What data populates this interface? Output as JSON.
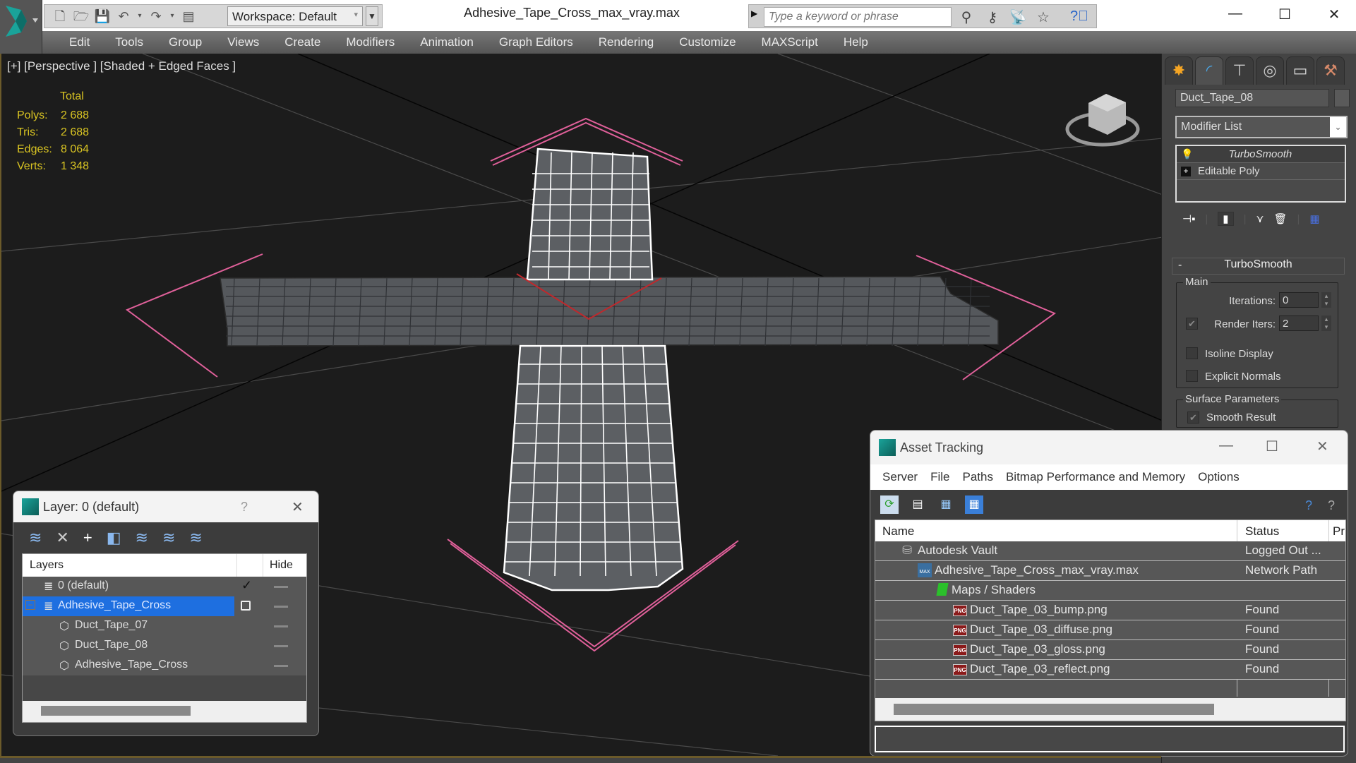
{
  "app": {
    "document_title": "Adhesive_Tape_Cross_max_vray.max",
    "workspace_label": "Workspace: Default",
    "search_placeholder": "Type a keyword or phrase",
    "window_controls": {
      "minimize": "—",
      "maximize": "☐",
      "close": "✕"
    }
  },
  "menubar": {
    "items": [
      "Edit",
      "Tools",
      "Group",
      "Views",
      "Create",
      "Modifiers",
      "Animation",
      "Graph Editors",
      "Rendering",
      "Customize",
      "MAXScript",
      "Help"
    ]
  },
  "viewport": {
    "label": "[+] [Perspective ] [Shaded + Edged Faces ]",
    "stats": {
      "header": "Total",
      "rows": [
        {
          "label": "Polys:",
          "value": "2 688"
        },
        {
          "label": "Tris:",
          "value": "2 688"
        },
        {
          "label": "Edges:",
          "value": "8 064"
        },
        {
          "label": "Verts:",
          "value": "1 348"
        }
      ]
    },
    "colors": {
      "background": "#1c1c1c",
      "stat_text": "#d9c422",
      "selection_bracket": "#e0609a",
      "wire": "#ffffff",
      "mesh": "#5a5c60",
      "axis": "#c0282c"
    }
  },
  "command_panel": {
    "tabs": [
      "create",
      "modify",
      "hierarchy",
      "motion",
      "display",
      "utilities"
    ],
    "object_name": "Duct_Tape_08",
    "modifier_list_label": "Modifier List",
    "stack": [
      {
        "label": "TurboSmooth",
        "italic": true
      },
      {
        "label": "Editable Poly",
        "italic": false
      }
    ],
    "turbosmooth": {
      "title": "TurboSmooth",
      "collapse": "-",
      "main_group": "Main",
      "iterations_label": "Iterations:",
      "iterations_value": "0",
      "render_iters_label": "Render Iters:",
      "render_iters_value": "2",
      "render_iters_checked": true,
      "isoline_label": "Isoline Display",
      "isoline_checked": false,
      "explicit_normals_label": "Explicit Normals",
      "explicit_normals_checked": false,
      "surface_group": "Surface Parameters",
      "smooth_result_label": "Smooth Result",
      "smooth_result_checked": true
    }
  },
  "layer_dialog": {
    "title": "Layer: 0 (default)",
    "help": "?",
    "close": "✕",
    "columns": {
      "layers": "Layers",
      "hide": "Hide"
    },
    "rows": [
      {
        "label": "0 (default)",
        "type": "layer",
        "active": true,
        "selected": false,
        "indent": 1
      },
      {
        "label": "Adhesive_Tape_Cross",
        "type": "layer",
        "active": false,
        "selected": true,
        "indent": 1,
        "expanded": true
      },
      {
        "label": "Duct_Tape_07",
        "type": "object",
        "active": false,
        "selected": false,
        "indent": 2
      },
      {
        "label": "Duct_Tape_08",
        "type": "object",
        "active": false,
        "selected": false,
        "indent": 2
      },
      {
        "label": "Adhesive_Tape_Cross",
        "type": "object",
        "active": false,
        "selected": false,
        "indent": 2
      }
    ],
    "selection_color": "#1e6fe0"
  },
  "asset_tracking": {
    "title": "Asset Tracking",
    "menu": [
      "Server",
      "File",
      "Paths",
      "Bitmap Performance and Memory",
      "Options"
    ],
    "columns": {
      "name": "Name",
      "status": "Status",
      "extra": "Pr"
    },
    "rows": [
      {
        "name": "Autodesk Vault",
        "status": "Logged Out ...",
        "icon": "vault-icon",
        "indent": 0
      },
      {
        "name": "Adhesive_Tape_Cross_max_vray.max",
        "status": "Network Path",
        "icon": "max-file-icon",
        "indent": 1
      },
      {
        "name": "Maps / Shaders",
        "status": "",
        "icon": "maps-icon",
        "indent": 2
      },
      {
        "name": "Duct_Tape_03_bump.png",
        "status": "Found",
        "icon": "png-icon",
        "indent": 3
      },
      {
        "name": "Duct_Tape_03_diffuse.png",
        "status": "Found",
        "icon": "png-icon",
        "indent": 3
      },
      {
        "name": "Duct_Tape_03_gloss.png",
        "status": "Found",
        "icon": "png-icon",
        "indent": 3
      },
      {
        "name": "Duct_Tape_03_reflect.png",
        "status": "Found",
        "icon": "png-icon",
        "indent": 3
      }
    ],
    "png_badge": "PNG"
  }
}
